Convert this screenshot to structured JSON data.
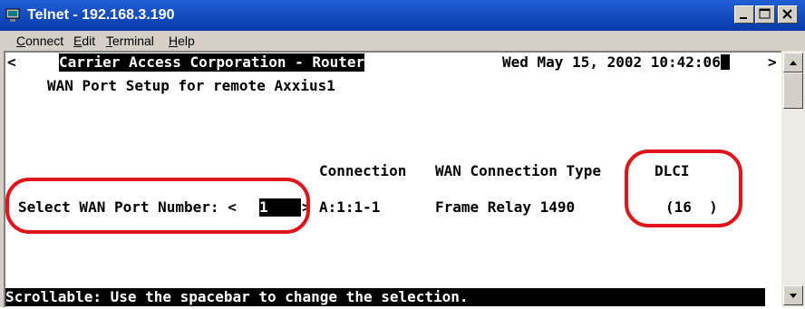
{
  "window": {
    "title": "Telnet - 192.168.3.190"
  },
  "menu": {
    "connect": "onnect",
    "connect_key": "C",
    "edit": "dit",
    "edit_key": "E",
    "terminal": "erminal",
    "terminal_key": "T",
    "help": "elp",
    "help_key": "H"
  },
  "terminal": {
    "scroll_left": "<",
    "scroll_right": ">",
    "header": "Carrier Access Corporation - Router",
    "datetime": "Wed May 15, 2002 10:42:06",
    "setup_title": "WAN Port Setup for remote Axxius1",
    "col_connection": "Connection",
    "col_type": "WAN Connection Type",
    "col_dlci": "DLCI",
    "select_label": "Select WAN Port Number: <",
    "port_value": "1",
    "port_close": ">",
    "connection": "A:1:1-1",
    "connection_type": "Frame Relay 1490",
    "dlci": "(16  )",
    "status": "Scrollable: Use the spacebar to change the selection."
  },
  "colors": {
    "titlebar": "#0a3aa7",
    "highlight_ring": "#e0141b",
    "inverse": "#000000"
  },
  "icons": {
    "app": "telnet-terminal-icon"
  }
}
